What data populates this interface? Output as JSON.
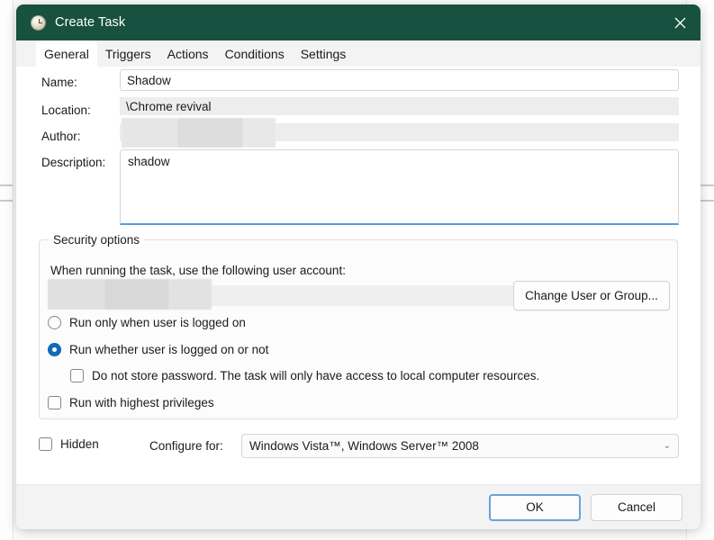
{
  "window": {
    "title": "Create Task",
    "icon": "clock-icon",
    "close_icon": "close-icon",
    "titlebar_color": "#18513f"
  },
  "tabs": [
    {
      "label": "General",
      "active": true
    },
    {
      "label": "Triggers",
      "active": false
    },
    {
      "label": "Actions",
      "active": false
    },
    {
      "label": "Conditions",
      "active": false
    },
    {
      "label": "Settings",
      "active": false
    }
  ],
  "general": {
    "name_label": "Name:",
    "name_value": "Shadow",
    "location_label": "Location:",
    "location_value": "\\Chrome revival",
    "author_label": "Author:",
    "author_value": "",
    "description_label": "Description:",
    "description_value": "shadow"
  },
  "security": {
    "legend": "Security options",
    "account_caption": "When running the task, use the following user account:",
    "account_value": "",
    "change_user_button": "Change User or Group...",
    "options": [
      {
        "id": "run-only-when-logged-on",
        "label": "Run only when user is logged on",
        "type": "radio",
        "checked": false
      },
      {
        "id": "run-whether-logged-on",
        "label": "Run whether user is logged on or not",
        "type": "radio",
        "checked": true
      },
      {
        "id": "do-not-store-password",
        "label": "Do not store password.  The task will only have access to local computer resources.",
        "type": "checkbox",
        "checked": false
      },
      {
        "id": "run-highest-privileges",
        "label": "Run with highest privileges",
        "type": "checkbox",
        "checked": false
      }
    ],
    "accent_color": "#0f6cbd"
  },
  "bottom": {
    "hidden_label": "Hidden",
    "hidden_checked": false,
    "configure_label": "Configure for:",
    "configure_value": "Windows Vista™, Windows Server™ 2008",
    "chevron": "⌄"
  },
  "footer": {
    "ok_label": "OK",
    "cancel_label": "Cancel",
    "focus_color": "#6aa3d8"
  }
}
